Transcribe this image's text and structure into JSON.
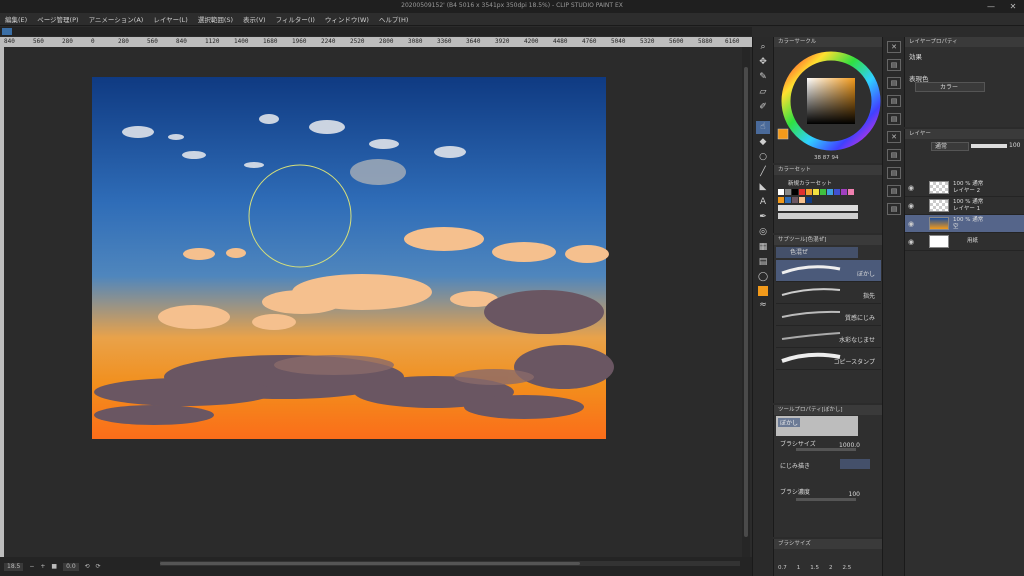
{
  "window": {
    "title": "20200509152' (B4 5016 x 3541px 350dpi 18.5%) - CLIP STUDIO PAINT EX",
    "minimize": "—",
    "close": "✕"
  },
  "menu": [
    "編集(E)",
    "ページ管理(P)",
    "アニメーション(A)",
    "レイヤー(L)",
    "選択範囲(S)",
    "表示(V)",
    "フィルター(I)",
    "ウィンドウ(W)",
    "ヘルプ(H)"
  ],
  "ruler_ticks": [
    "840",
    "560",
    "280",
    "0",
    "280",
    "560",
    "840",
    "1120",
    "1400",
    "1680",
    "1960",
    "2240",
    "2520",
    "2800",
    "3080",
    "3360",
    "3640",
    "3920",
    "4200",
    "4480",
    "4760",
    "5040",
    "5320",
    "5600",
    "5880",
    "6160"
  ],
  "status": {
    "zoom": "18.5",
    "angle": "0.0"
  },
  "color_wheel": {
    "title": "カラーサークル",
    "hsv_readout": "38  87  94",
    "current_color": "#f29a1b"
  },
  "color_set": {
    "title": "カラーセット",
    "dropdown": "新規カラーセット"
  },
  "sub_tool": {
    "title": "サブツール[色混ぜ]",
    "group": "色混ぜ",
    "brushes": [
      "ぼかし",
      "指先",
      "質感にじみ",
      "水彩なじませ",
      "コピースタンプ"
    ]
  },
  "tool_property": {
    "title": "ツールプロパティ[ぼかし]",
    "preview_label": "ぼかし",
    "brush_size_label": "ブラシサイズ",
    "brush_size_value": "1000.0",
    "blur_label": "にじみ描き",
    "density_label": "ブラシ濃度",
    "density_value": "100"
  },
  "brush_size_panel": {
    "title": "ブラシサイズ",
    "sizes": [
      "0.7",
      "1",
      "1.5",
      "2",
      "2.5"
    ]
  },
  "layer_property": {
    "title": "レイヤープロパティ",
    "effect_label": "効果",
    "expression_label": "表現色",
    "expression_value": "カラー"
  },
  "layers": {
    "title": "レイヤー",
    "blend_mode": "通常",
    "opacity": "100",
    "rows": [
      {
        "line1": "100 % 通常",
        "line2": "レイヤー 2"
      },
      {
        "line1": "100 % 通常",
        "line2": "レイヤー 1"
      },
      {
        "line1": "100 % 通常",
        "line2": "空"
      },
      {
        "line1": "",
        "line2": "用紙"
      }
    ]
  }
}
